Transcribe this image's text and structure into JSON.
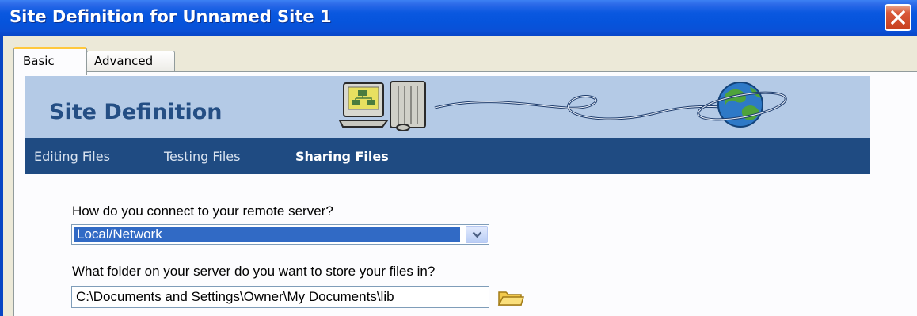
{
  "window": {
    "title": "Site Definition for Unnamed Site 1"
  },
  "tabs": [
    {
      "label": "Basic",
      "active": true
    },
    {
      "label": "Advanced",
      "active": false
    }
  ],
  "banner": {
    "title": "Site Definition",
    "art_icons": [
      "computer-icon",
      "globe-icon"
    ]
  },
  "nav": [
    {
      "label": "Editing Files",
      "active": false
    },
    {
      "label": "Testing Files",
      "active": false
    },
    {
      "label": "Sharing Files",
      "active": true
    }
  ],
  "form": {
    "connect_question": "How do you connect to your remote server?",
    "connect_value": "Local/Network",
    "folder_question": "What folder on your server do you want to store your files in?",
    "folder_value": "C:\\Documents and Settings\\Owner\\My Documents\\lib",
    "folder_icon": "folder-icon"
  },
  "colors": {
    "titlebar": "#0A58E0",
    "banner": "#B4CAE6",
    "navbar": "#1F4B82",
    "selection": "#316AC5",
    "close_button": "#D9593A"
  }
}
